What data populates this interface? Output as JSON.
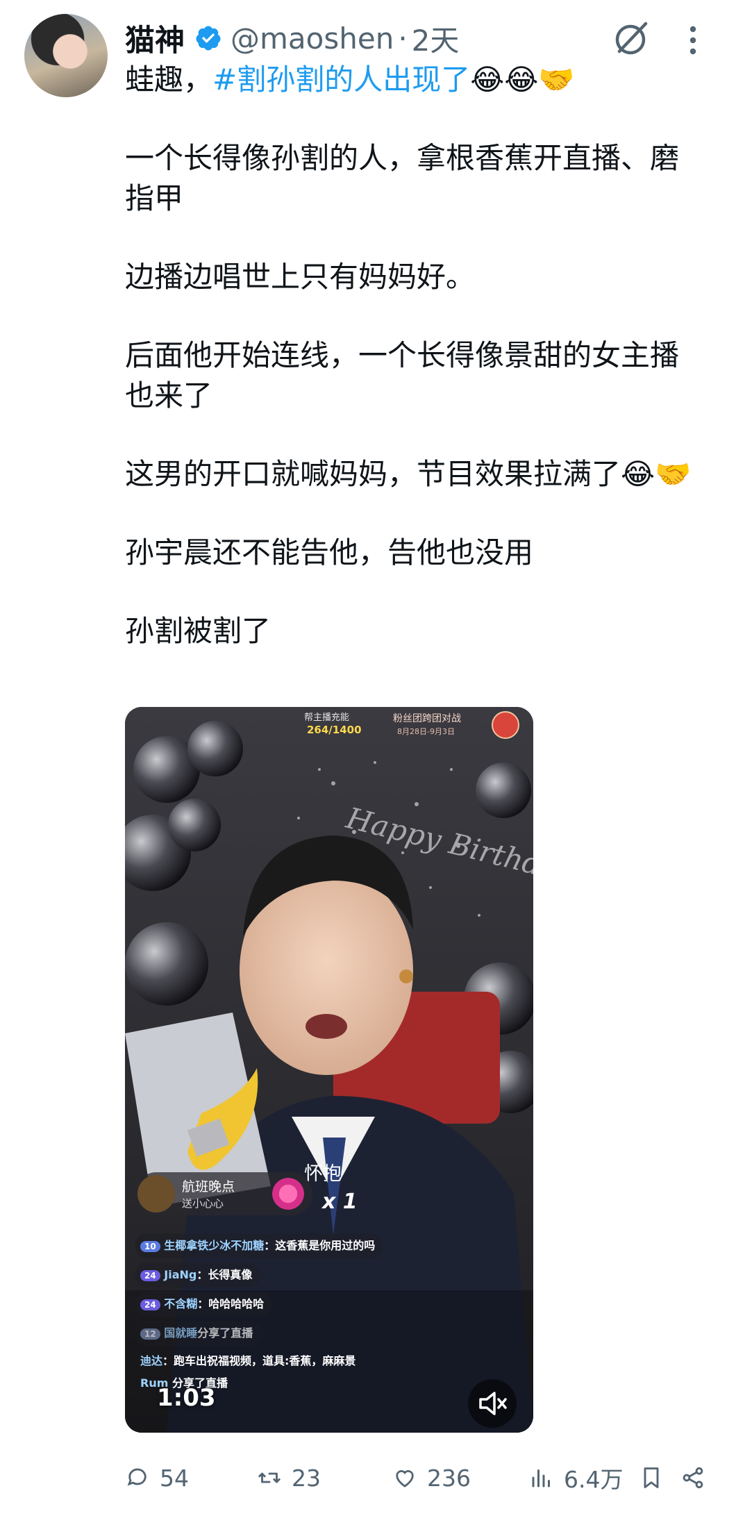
{
  "post": {
    "author_name": "猫神",
    "author_handle": "@maoshen",
    "time_sep": "·",
    "time_ago": "2天",
    "lines": [
      "一个长得像孙割的人，拿根香蕉开直播、磨指甲",
      "边播边唱世上只有妈妈好。",
      "后面他开始连线，一个长得像景甜的女主播也来了",
      "这男的开口就喊妈妈，节目效果拉满了😂🤝",
      "孙宇晨还不能告他，告他也没用",
      "孙割被割了"
    ],
    "intro": "蛙趣，",
    "hashtag": "#割孙割的人出现了",
    "intro_emoji": "😂😂🤝"
  },
  "video": {
    "duration": "1:03",
    "overlay": {
      "top_label": "帮主播充能",
      "progress_text": "264/1400",
      "battle_title": "粉丝团跨团对战",
      "battle_dates": "8月28日-9月3日",
      "bg_text": "Happy Birthday",
      "hug_text": "怀抱",
      "gift_user": "航班晚点",
      "gift_desc": "送小心心",
      "gift_count": "x 1",
      "comments": [
        {
          "level": "10",
          "user": "生椰拿铁少冰不加糖",
          "text": "：这香蕉是你用过的吗"
        },
        {
          "level": "24",
          "user": "JiaNg",
          "text": "：长得真像"
        },
        {
          "level": "24",
          "user": "不含糊",
          "text": "：哈哈哈哈哈"
        },
        {
          "level": "12",
          "user": "国就睡",
          "text": "分享了直播"
        },
        {
          "level": "",
          "user": "迪达",
          "text": "：跑车出祝福视频，道具:香蕉，麻麻景"
        },
        {
          "level": "",
          "user": "Rum",
          "text": "分享了直播"
        }
      ]
    }
  },
  "actions": {
    "replies": "54",
    "reposts": "23",
    "likes": "236",
    "views": "6.4万"
  },
  "colors": {
    "accent": "#1d9bf0",
    "text": "#0f1419",
    "muted": "#536471"
  }
}
